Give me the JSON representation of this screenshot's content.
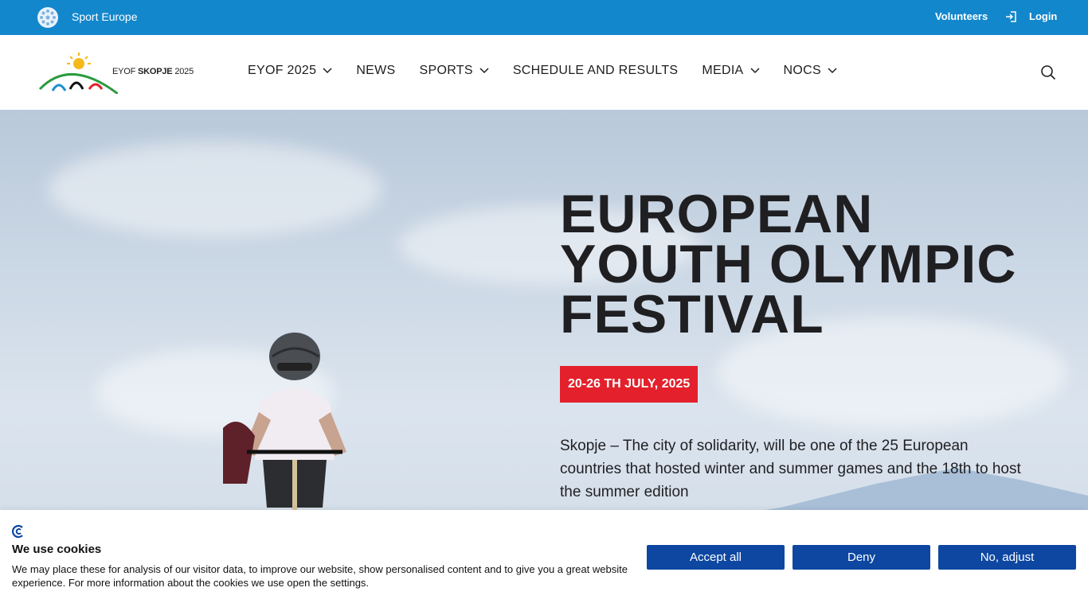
{
  "topbar": {
    "brand_name": "Sport Europe",
    "volunteers": "Volunteers",
    "login": "Login"
  },
  "header": {
    "logo_text_prefix": "EYOF",
    "logo_text_city": "SKOPJE",
    "logo_text_year": "2025",
    "nav": [
      {
        "label": "EYOF 2025",
        "has_dropdown": true
      },
      {
        "label": "NEWS",
        "has_dropdown": false
      },
      {
        "label": "SPORTS",
        "has_dropdown": true
      },
      {
        "label": "SCHEDULE AND RESULTS",
        "has_dropdown": false
      },
      {
        "label": "MEDIA",
        "has_dropdown": true
      },
      {
        "label": "NOCS",
        "has_dropdown": true
      }
    ],
    "search_icon": "search-icon"
  },
  "hero": {
    "title_lines": [
      "EUROPEAN",
      "YOUTH OLYMPIC",
      "FESTIVAL"
    ],
    "date": "20-26 TH JULY, 2025",
    "description": "Skopje – The city of solidarity, will be one of the 25 European countries that hosted winter and summer games and the 18th to host the summer edition"
  },
  "cookie": {
    "title": "We use cookies",
    "text": "We may place these for analysis of our visitor data, to improve our website, show personalised content and to give you a great website experience. For more information about the cookies we use open the settings.",
    "accept": "Accept all",
    "deny": "Deny",
    "adjust": "No, adjust"
  },
  "colors": {
    "topbar": "#1387cc",
    "badge": "#e3202b",
    "cookie_button": "#0d47a1",
    "text_dark": "#1f1f22"
  }
}
